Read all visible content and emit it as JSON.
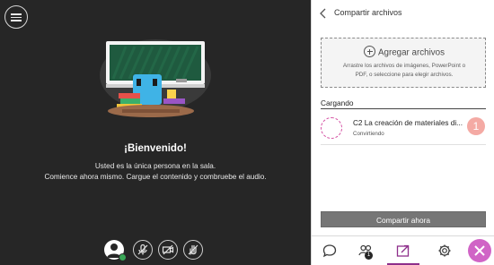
{
  "stage": {
    "menu_icon": "hamburger-menu-icon",
    "welcome_title": "¡Bienvenido!",
    "welcome_line1": "Usted es la única persona en la sala.",
    "welcome_line2": "Comience ahora mismo. Cargue el contenido y combruebe el audio.",
    "controls": [
      {
        "name": "avatar",
        "icon": "user-avatar-icon",
        "status": "online"
      },
      {
        "name": "microphone",
        "icon": "microphone-muted-icon"
      },
      {
        "name": "camera",
        "icon": "camera-off-icon"
      },
      {
        "name": "hand",
        "icon": "raise-hand-icon"
      }
    ]
  },
  "panel": {
    "title": "Compartir archivos",
    "back_icon": "chevron-left-icon",
    "upload": {
      "label": "Agregar archivos",
      "help_line1": "Arrastre los archivos de imágenes, PowerPoint o",
      "help_line2": "PDF, o seleccione para elegir archivos."
    },
    "section_label": "Cargando",
    "file": {
      "name": "C2 La creación de materiales di...",
      "status": "Convirtiendo",
      "step_badge": "1"
    },
    "share_button": "Compartir ahora",
    "tabs": [
      {
        "name": "chat",
        "icon": "chat-bubble-icon"
      },
      {
        "name": "attendees",
        "icon": "attendees-icon",
        "count": "1"
      },
      {
        "name": "share",
        "icon": "share-content-icon",
        "active": true
      },
      {
        "name": "settings",
        "icon": "gear-icon"
      },
      {
        "name": "close",
        "icon": "close-icon"
      }
    ]
  },
  "colors": {
    "stage_bg": "#262626",
    "accent_purple": "#8e2f8b",
    "close_pink": "#d064c6",
    "status_green": "#39a657",
    "badge_salmon": "#f4aaa4",
    "spinner_magenta": "#d44fa2"
  }
}
